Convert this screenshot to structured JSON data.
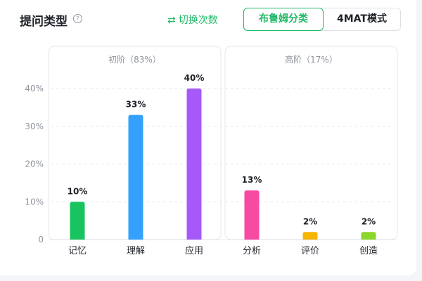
{
  "header": {
    "title": "提问类型",
    "help_icon": "question-circle-icon",
    "switch_label": "切换次数",
    "switch_icon": "swap-arrows-icon",
    "tabs": [
      {
        "label": "布鲁姆分类",
        "active": true
      },
      {
        "label": "4MAT模式",
        "active": false
      }
    ]
  },
  "colors": {
    "accent": "#1db964",
    "记忆": "#19c35f",
    "理解": "#33a1fd",
    "应用": "#a659f8",
    "分析": "#f74aa1",
    "评价": "#f7b500",
    "创造": "#8bd62b"
  },
  "chart_data": {
    "type": "bar",
    "ylim": [
      0,
      40
    ],
    "yticks": [
      "0",
      "10%",
      "20%",
      "30%",
      "40%"
    ],
    "grid": true,
    "groups": [
      {
        "label": "初阶（83%）",
        "categories": [
          "记忆",
          "理解",
          "应用"
        ],
        "values": [
          10,
          33,
          40
        ],
        "labels": [
          "10%",
          "33%",
          "40%"
        ]
      },
      {
        "label": "高阶（17%）",
        "categories": [
          "分析",
          "评价",
          "创造"
        ],
        "values": [
          13,
          2,
          2
        ],
        "labels": [
          "13%",
          "2%",
          "2%"
        ]
      }
    ]
  }
}
